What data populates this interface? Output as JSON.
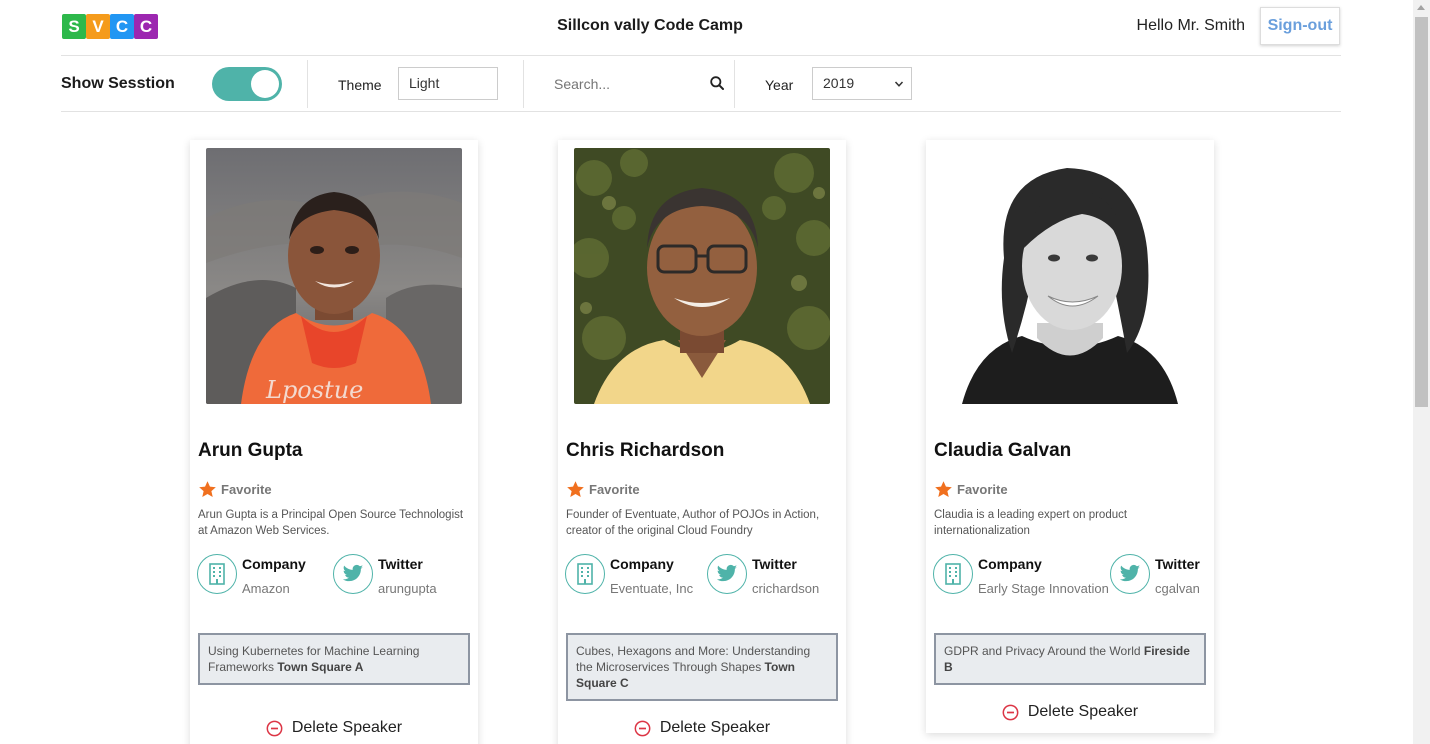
{
  "header": {
    "logo_letters": [
      "S",
      "V",
      "C",
      "C"
    ],
    "logo_colors": [
      "#2db84b",
      "#f59b1b",
      "#2196f3",
      "#9c27b0"
    ],
    "title": "Sillcon vally Code Camp",
    "greeting": "Hello Mr. Smith",
    "signout_label": "Sign-out"
  },
  "toolbar": {
    "show_session_label": "Show Sesstion",
    "show_session_on": true,
    "theme_label": "Theme",
    "theme_value": "Light",
    "search_placeholder": "Search...",
    "year_label": "Year",
    "year_value": "2019"
  },
  "colors": {
    "accent": "#4fb3a9",
    "star": "#f0701f",
    "delete": "#dc3545",
    "signout_text": "#6a9fdc"
  },
  "speakers": [
    {
      "name": "Arun Gupta",
      "favorite_label": "Favorite",
      "bio": "Arun Gupta is a Principal Open Source Technologist at Amazon Web Services.",
      "company_label": "Company",
      "company": "Amazon",
      "twitter_label": "Twitter",
      "twitter": "arungupta",
      "session_title": "Using Kubernetes for Machine Learning Frameworks",
      "session_room": "Town Square A",
      "delete_label": "Delete Speaker"
    },
    {
      "name": "Chris Richardson",
      "favorite_label": "Favorite",
      "bio": "Founder of Eventuate, Author of POJOs in Action, creator of the original Cloud Foundry",
      "company_label": "Company",
      "company": "Eventuate, Inc",
      "twitter_label": "Twitter",
      "twitter": "crichardson",
      "session_title": "Cubes, Hexagons and More: Understanding the Microservices Through Shapes",
      "session_room": "Town Square C",
      "delete_label": "Delete Speaker"
    },
    {
      "name": "Claudia Galvan",
      "favorite_label": "Favorite",
      "bio": "Claudia is a leading expert on product internationalization",
      "company_label": "Company",
      "company": "Early Stage Innovation",
      "twitter_label": "Twitter",
      "twitter": "cgalvan",
      "session_title": "GDPR and Privacy Around the World",
      "session_room": "Fireside B",
      "delete_label": "Delete Speaker"
    }
  ],
  "icons": {
    "company": "building-icon",
    "twitter": "twitter-bird-icon",
    "favorite": "star-icon",
    "delete": "minus-circle-icon",
    "search": "search-icon",
    "year_dropdown": "chevron-down-icon"
  }
}
